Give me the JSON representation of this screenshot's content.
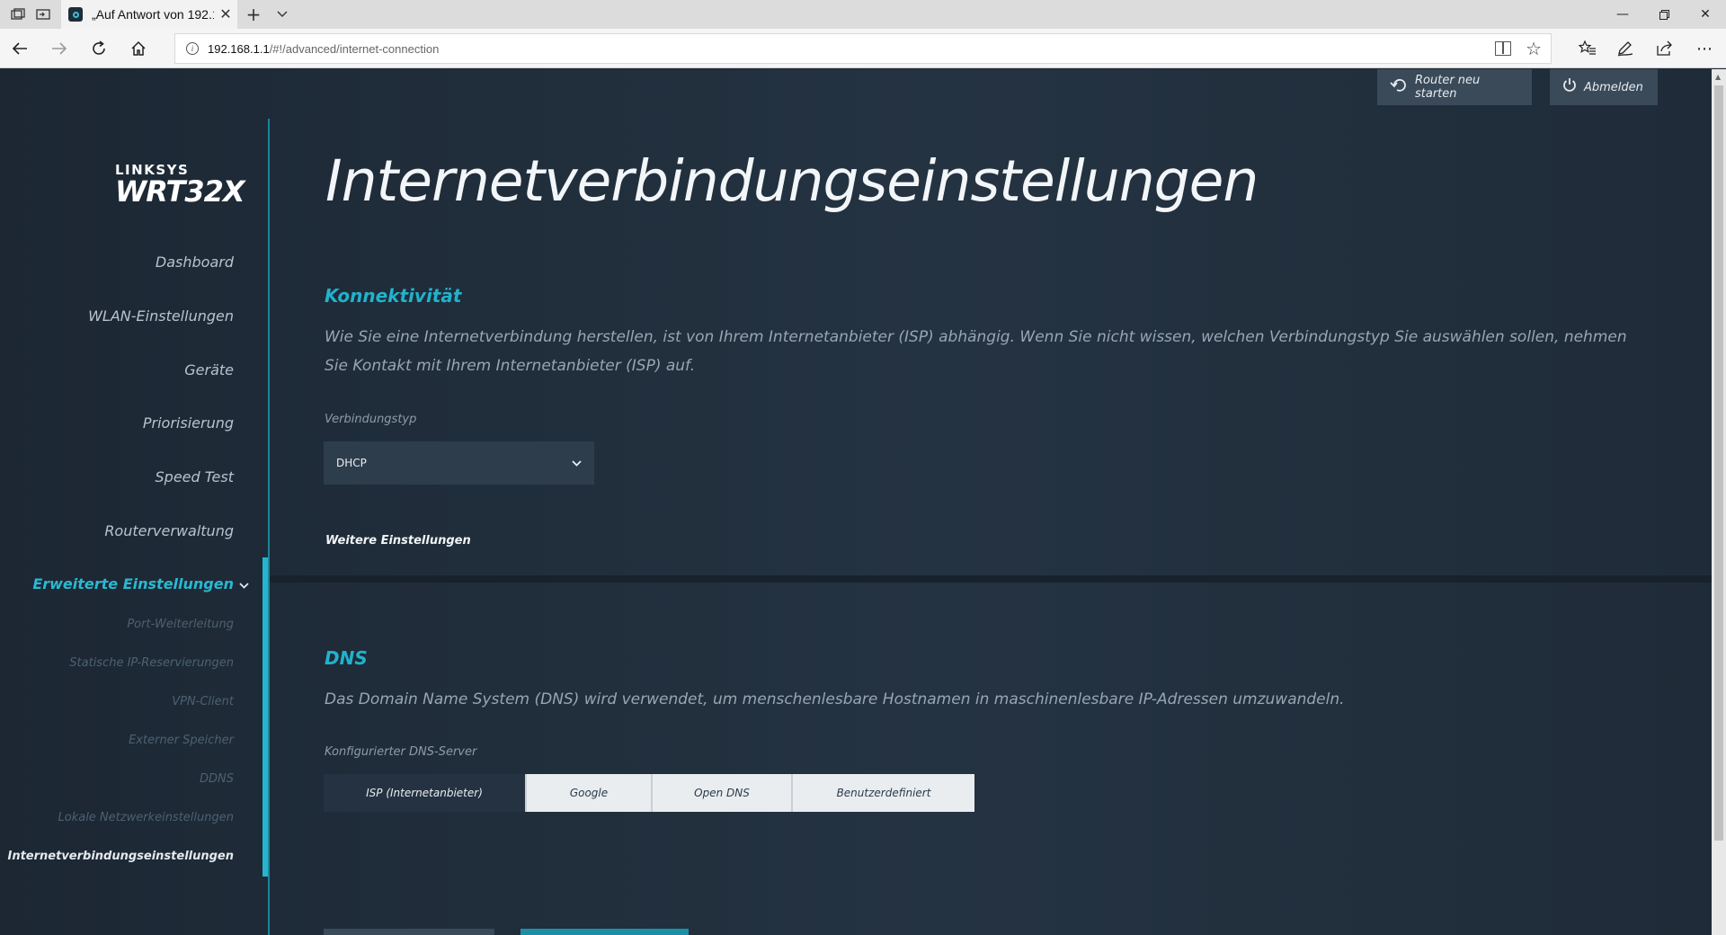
{
  "browser": {
    "tab_title": "„Auf Antwort von 192.1",
    "url_host": "192.168.1.1",
    "url_path": "/#!/advanced/internet-connection",
    "icons": [
      "tab-preview-icon",
      "tab-aside-icon",
      "new-tab-icon",
      "tab-list-chevron-icon",
      "back-icon",
      "forward-icon",
      "refresh-icon",
      "home-icon",
      "reading-view-icon",
      "favorite-star-icon",
      "favorites-hub-icon",
      "pen-icon",
      "share-icon",
      "more-icon"
    ]
  },
  "header": {
    "restart_label": "Router neu starten",
    "logout_label": "Abmelden"
  },
  "logo": {
    "brand": "LINKSYS",
    "model": "WRT32X"
  },
  "sidebar": {
    "items": [
      {
        "label": "Dashboard"
      },
      {
        "label": "WLAN-Einstellungen"
      },
      {
        "label": "Geräte"
      },
      {
        "label": "Priorisierung"
      },
      {
        "label": "Speed Test"
      },
      {
        "label": "Routerverwaltung"
      },
      {
        "label": "Erweiterte Einstellungen"
      }
    ],
    "subitems": [
      {
        "label": "Port-Weiterleitung"
      },
      {
        "label": "Statische IP-Reservierungen"
      },
      {
        "label": "VPN-Client"
      },
      {
        "label": "Externer Speicher"
      },
      {
        "label": "DDNS"
      },
      {
        "label": "Lokale Netzwerkeinstellungen"
      },
      {
        "label": "Internetverbindungseinstellungen"
      }
    ]
  },
  "main": {
    "title": "Internetverbindungseinstellungen",
    "connectivity": {
      "heading": "Konnektivität",
      "description": "Wie Sie eine Internetverbindung herstellen, ist von Ihrem Internetanbieter (ISP) abhängig. Wenn Sie nicht wissen, welchen Verbindungstyp Sie auswählen sollen, nehmen Sie Kontakt mit Ihrem Internetanbieter (ISP) auf.",
      "type_label": "Verbindungstyp",
      "type_value": "DHCP",
      "more_settings": "Weitere Einstellungen"
    },
    "dns": {
      "heading": "DNS",
      "description": "Das Domain Name System (DNS) wird verwendet, um menschenlesbare Hostnamen in maschinenlesbare IP-Adressen umzuwandeln.",
      "server_label": "Konfigurierter DNS-Server",
      "options": [
        "ISP (Internetanbieter)",
        "Google",
        "Open DNS",
        "Benutzerdefiniert"
      ],
      "selected": "ISP (Internetanbieter)"
    }
  },
  "colors": {
    "accent": "#21b2cc",
    "background": "#1d2834",
    "panel": "#2e3d4c"
  }
}
